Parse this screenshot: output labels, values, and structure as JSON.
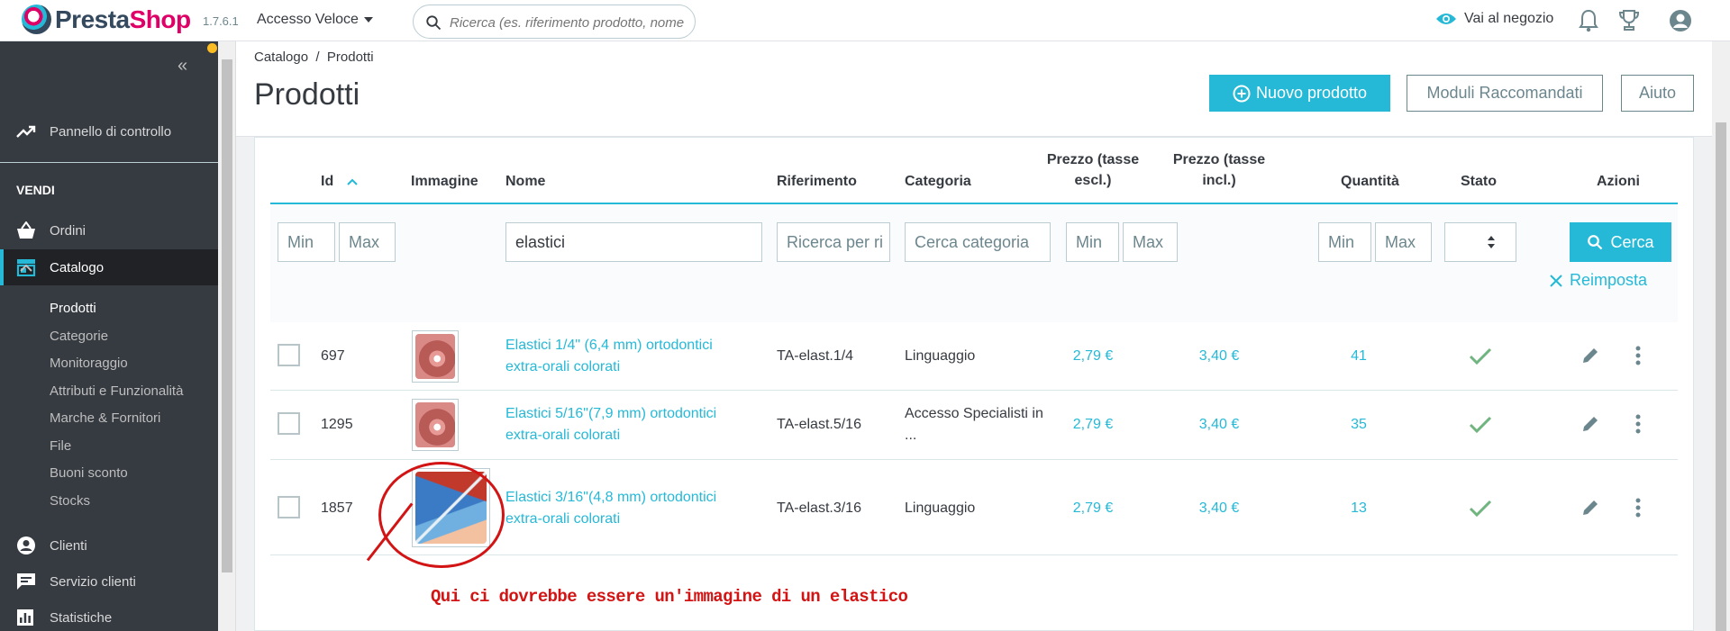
{
  "header": {
    "logo_text_a": "Presta",
    "logo_text_b": "Shop",
    "version": "1.7.6.1",
    "quick_access": "Accesso Veloce",
    "search_placeholder": "Ricerca (es. riferimento prodotto, nome",
    "shop_link": "Vai al negozio"
  },
  "sidebar": {
    "dashboard": "Pannello di controllo",
    "section_sell": "VENDI",
    "orders": "Ordini",
    "catalog": "Catalogo",
    "catalog_sub": [
      "Prodotti",
      "Categorie",
      "Monitoraggio",
      "Attributi e Funzionalità",
      "Marche & Fornitori",
      "File",
      "Buoni sconto",
      "Stocks"
    ],
    "customers": "Clienti",
    "customer_service": "Servizio clienti",
    "stats": "Statistiche"
  },
  "page": {
    "breadcrumb": "Catalogo  /  Prodotti",
    "title": "Prodotti",
    "new_product": "Nuovo prodotto",
    "recommended_modules": "Moduli Raccomandati",
    "help": "Aiuto"
  },
  "table": {
    "headers": {
      "id": "Id",
      "image": "Immagine",
      "name": "Nome",
      "reference": "Riferimento",
      "category": "Categoria",
      "price_excl_1": "Prezzo (tasse",
      "price_excl_2": "escl.)",
      "price_incl_1": "Prezzo (tasse",
      "price_incl_2": "incl.)",
      "quantity": "Quantità",
      "status": "Stato",
      "actions": "Azioni"
    },
    "filters": {
      "id_min": "Min",
      "id_max": "Max",
      "name_value": "elastici",
      "reference_placeholder": "Ricerca per ri",
      "category_placeholder": "Cerca categoria",
      "price_min": "Min",
      "price_max": "Max",
      "qty_min": "Min",
      "qty_max": "Max",
      "search_button": "Cerca",
      "reset": "Reimposta"
    },
    "rows": [
      {
        "id": "697",
        "name_1": "Elastici 1/4\" (6,4 mm) ortodontici",
        "name_2": "extra-orali colorati",
        "reference": "TA-elast.1/4",
        "category_1": "Linguaggio",
        "category_2": "",
        "price_excl": "2,79 €",
        "price_incl": "3,40 €",
        "quantity": "41"
      },
      {
        "id": "1295",
        "name_1": "Elastici 5/16\"(7,9 mm) ortodontici",
        "name_2": "extra-orali colorati",
        "reference": "TA-elast.5/16",
        "category_1": "Accesso Specialisti in",
        "category_2": "...",
        "price_excl": "2,79 €",
        "price_incl": "3,40 €",
        "quantity": "35"
      },
      {
        "id": "1857",
        "name_1": "Elastici 3/16\"(4,8 mm) ortodontici",
        "name_2": "extra-orali colorati",
        "reference": "TA-elast.3/16",
        "category_1": "Linguaggio",
        "category_2": "",
        "price_excl": "2,79 €",
        "price_incl": "3,40 €",
        "quantity": "13"
      }
    ]
  },
  "annotation": {
    "text": "Qui ci dovrebbe essere un'immagine di un elastico",
    "color": "#d21414"
  },
  "colors": {
    "accent": "#25b9d7",
    "sidebar": "#363a41",
    "success": "#70b580"
  }
}
